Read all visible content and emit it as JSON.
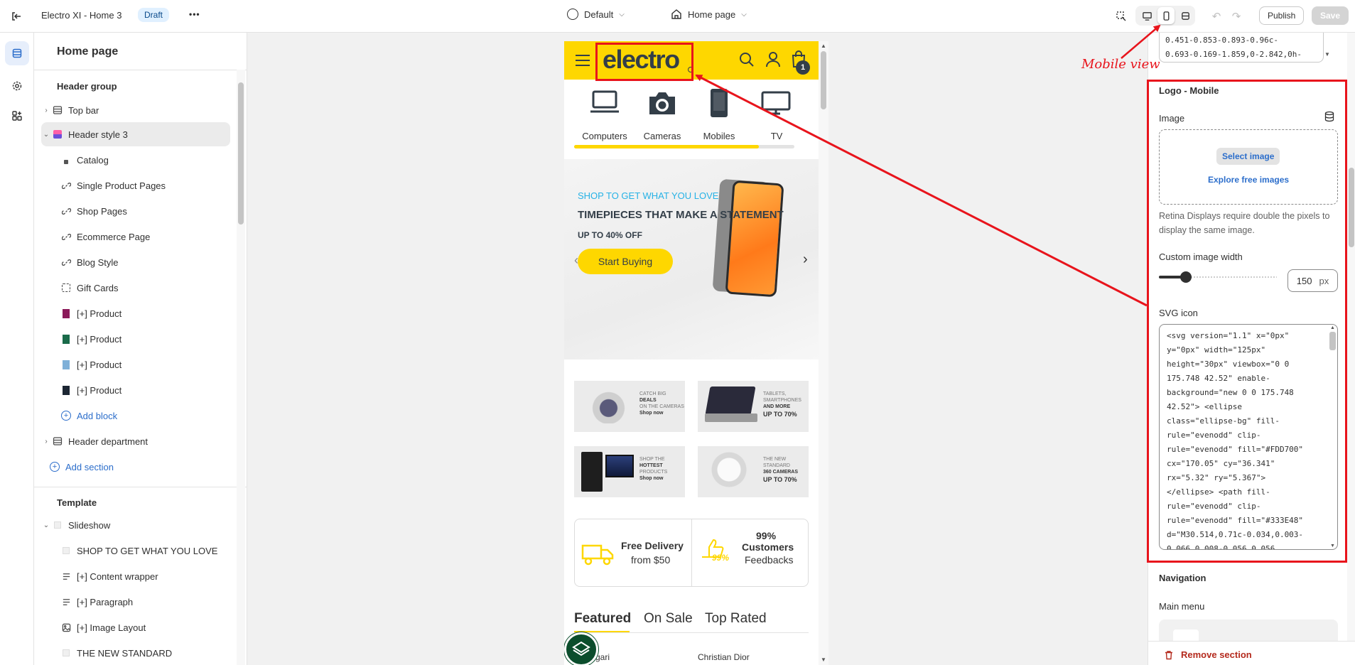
{
  "topbar": {
    "theme_name": "Electro XI - Home 3",
    "status_badge": "Draft",
    "more_label": "•••",
    "theme_select": "Default",
    "page_select": "Home page",
    "publish_label": "Publish",
    "save_label": "Save"
  },
  "annotation": {
    "mobile_view_label": "Mobile view"
  },
  "left_panel": {
    "title": "Home page",
    "header_group_label": "Header group",
    "items": [
      {
        "label": "Top bar"
      },
      {
        "label": "Header style 3"
      },
      {
        "label": "Catalog"
      },
      {
        "label": "Single Product Pages"
      },
      {
        "label": "Shop Pages"
      },
      {
        "label": "Ecommerce Page"
      },
      {
        "label": "Blog Style"
      },
      {
        "label": "Gift Cards"
      },
      {
        "label": "[+] Product"
      },
      {
        "label": "[+] Product"
      },
      {
        "label": "[+] Product"
      },
      {
        "label": "[+] Product"
      },
      {
        "label": "Add block"
      },
      {
        "label": "Header department"
      },
      {
        "label": "Add section"
      }
    ],
    "template_label": "Template",
    "template_items": [
      {
        "label": "Slideshow"
      },
      {
        "label": "SHOP TO GET WHAT YOU LOVE"
      },
      {
        "label": "[+] Content wrapper"
      },
      {
        "label": "[+] Paragraph"
      },
      {
        "label": "[+] Image Layout"
      },
      {
        "label": "THE NEW STANDARD"
      }
    ]
  },
  "preview": {
    "logo_text": "electro",
    "cart_count": "1",
    "categories": [
      "Computers",
      "Cameras",
      "Mobiles",
      "TV"
    ],
    "slide": {
      "kicker": "SHOP TO GET WHAT YOU LOVE",
      "headline": "TIMEPIECES THAT MAKE A STATEMENT",
      "subhead": "UP TO 40% OFF",
      "cta": "Start Buying"
    },
    "promos": [
      {
        "line1": "CATCH BIG",
        "line2": "DEALS",
        "line3": "ON THE CAMERAS",
        "cta": "Shop now"
      },
      {
        "line1": "TABLETS,",
        "line2": "SMARTPHONES",
        "line3": "AND MORE",
        "cta": "UP TO 70%"
      },
      {
        "line1": "SHOP THE",
        "line2": "HOTTEST",
        "line3": "PRODUCTS",
        "cta": "Shop now"
      },
      {
        "line1": "THE NEW STANDARD",
        "line2": "360 CAMERAS",
        "line3": "",
        "cta": "UP TO 70%"
      }
    ],
    "features": {
      "delivery_title": "Free Delivery",
      "delivery_sub": "from $50",
      "badge": "99%",
      "customers_pct": "99%",
      "customers_title": "Customers",
      "customers_sub": "Feedbacks"
    },
    "tabs": [
      "Featured",
      "On Sale",
      "Top Rated"
    ],
    "products": [
      "...gari",
      "Christian Dior"
    ]
  },
  "right_panel": {
    "code_top": "0.451-0.853-0.893-0.96c-\n0.693-0.169-1.859,0-2.842,0h-",
    "section_title": "Logo - Mobile",
    "image_label": "Image",
    "select_image": "Select image",
    "explore_images": "Explore free images",
    "retina_help": "Retina Displays require double the pixels to display the same image.",
    "width_label": "Custom image width",
    "width_value": "150",
    "width_unit": "px",
    "width_fraction": 0.23,
    "svg_label": "SVG icon",
    "svg_code": "<svg version=\"1.1\" x=\"0px\"\ny=\"0px\" width=\"125px\"\nheight=\"30px\" viewbox=\"0 0\n175.748 42.52\" enable-\nbackground=\"new 0 0 175.748\n42.52\"> <ellipse\nclass=\"ellipse-bg\" fill-\nrule=\"evenodd\" clip-\nrule=\"evenodd\" fill=\"#FDD700\"\ncx=\"170.05\" cy=\"36.341\"\nrx=\"5.32\" ry=\"5.367\">\n</ellipse> <path fill-\nrule=\"evenodd\" clip-\nrule=\"evenodd\" fill=\"#333E48\"\nd=\"M30.514,0.71c-0.034,0.003-\n0.066,0.008-0.056,0.056",
    "navigation_title": "Navigation",
    "main_menu_label": "Main menu",
    "remove_section": "Remove section"
  },
  "colors": {
    "accent_yellow": "#FED700",
    "annotation_red": "#E8141C",
    "link_blue": "#2C6ECB"
  }
}
